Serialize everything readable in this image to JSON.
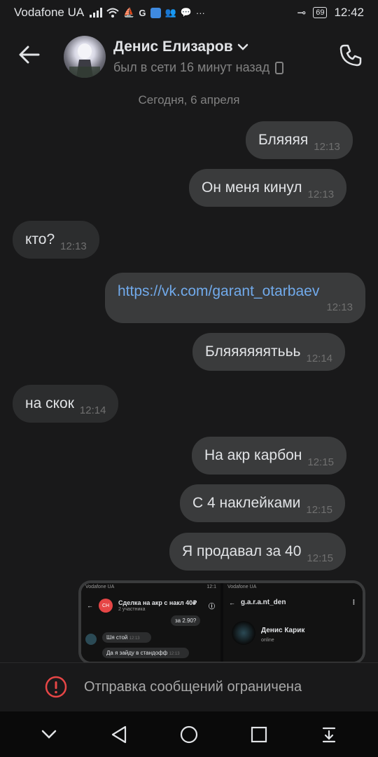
{
  "status_bar": {
    "carrier": "Vodafone UA",
    "battery": "69",
    "time": "12:42"
  },
  "header": {
    "name": "Денис Елизаров",
    "status": "был в сети 16 минут назад"
  },
  "date_separator": "Сегодня, 6 апреля",
  "messages": [
    {
      "text": "Бляяяя",
      "time": "12:13",
      "dir": "out"
    },
    {
      "text": "Он меня кинул",
      "time": "12:13",
      "dir": "out"
    },
    {
      "text": "кто?",
      "time": "12:13",
      "dir": "in"
    },
    {
      "text": "https://vk.com/garant_otarbaev",
      "time": "12:13",
      "dir": "out"
    },
    {
      "text": "Бляяяяяятььь",
      "time": "12:14",
      "dir": "out"
    },
    {
      "text": "на скок",
      "time": "12:14",
      "dir": "in"
    },
    {
      "text": "На акр карбон",
      "time": "12:15",
      "dir": "out"
    },
    {
      "text": "С 4 наклейками",
      "time": "12:15",
      "dir": "out"
    },
    {
      "text": "Я продавал за 40",
      "time": "12:15",
      "dir": "out"
    }
  ],
  "attachment": {
    "left": {
      "carrier": "Vodafone UA",
      "time": "12:1",
      "avatar_text": "СН",
      "title": "Сделка на акр с накл 40₽",
      "subtitle": "2 участника",
      "msg_top": "за 2.90?",
      "msg1": "Шя стой",
      "msg1_time": "12:13",
      "msg2": "Да я зайду в стандофф",
      "msg2_time": "12:13"
    },
    "right": {
      "carrier": "Vodafone UA",
      "title": "g.a.r.a.nt_den",
      "name": "Денис Карик",
      "status": "online"
    }
  },
  "restricted_text": "Отправка сообщений ограничена"
}
